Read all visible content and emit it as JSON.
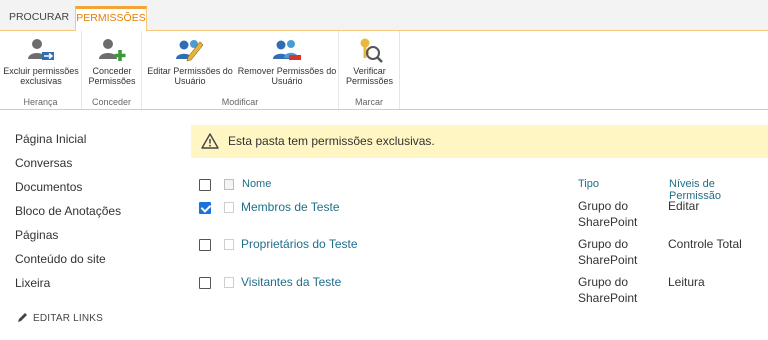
{
  "tabs": {
    "procurar": "PROCURAR",
    "permissoes": "PERMISSÕES"
  },
  "ribbon": {
    "heranca": {
      "label": "Herança",
      "excluir": "Excluir permissões exclusivas"
    },
    "conceder": {
      "label": "Conceder",
      "conceder": "Conceder Permissões"
    },
    "modificar": {
      "label": "Modificar",
      "editar": "Editar Permissões do Usuário",
      "remover": "Remover Permissões do Usuário"
    },
    "marcar": {
      "label": "Marcar",
      "verificar": "Verificar Permissões"
    }
  },
  "nav": {
    "items": [
      "Página Inicial",
      "Conversas",
      "Documentos",
      "Bloco de Anotações",
      "Páginas",
      "Conteúdo do site",
      "Lixeira"
    ],
    "edit_links": "EDITAR LINKS"
  },
  "notice": "Esta pasta tem permissões exclusivas.",
  "table": {
    "headers": {
      "name": "Nome",
      "tipo": "Tipo",
      "niveis": "Níveis de Permissão"
    },
    "rows": [
      {
        "name": "Membros de Teste",
        "tipo": "Grupo do SharePoint",
        "nivel": "Editar",
        "checked": true
      },
      {
        "name": "Proprietários do Teste",
        "tipo": "Grupo do SharePoint",
        "nivel": "Controle Total",
        "checked": false
      },
      {
        "name": "Visitantes da Teste",
        "tipo": "Grupo do SharePoint",
        "nivel": "Leitura",
        "checked": false
      }
    ]
  },
  "colors": {
    "accent": "#f3a435",
    "link": "#1f6f8b",
    "notice_bg": "#fff6c4",
    "check": "#1a73d8"
  }
}
